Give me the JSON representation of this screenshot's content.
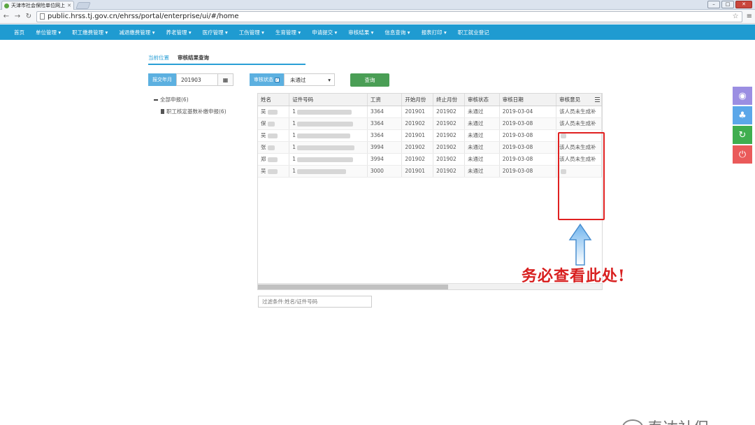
{
  "browser": {
    "tab_title": "天津市社会保险单位网上",
    "url": "public.hrss.tj.gov.cn/ehrss/portal/enterprise/ui/#/home"
  },
  "nav": {
    "items": [
      "首页",
      "单位管理 ▾",
      "职工缴费管理 ▾",
      "减退缴费管理 ▾",
      "养老管理 ▾",
      "医疗管理 ▾",
      "工伤管理 ▾",
      "生育管理 ▾",
      "申请提交 ▾",
      "审核结果 ▾",
      "信息查询 ▾",
      "报表打印 ▾",
      "职工就业登记"
    ]
  },
  "breadcrumb": {
    "label": "当前位置",
    "current": "审核结果查询"
  },
  "filters": {
    "period_label": "报交年月",
    "period_value": "201903",
    "status_label": "审核状态",
    "status_value": "未通过",
    "search_label": "查询"
  },
  "tree": {
    "root": "全部申报(6)",
    "child": "职工核定基数补缴申报(6)"
  },
  "table": {
    "columns": [
      "姓名",
      "证件号码",
      "工资",
      "开始月份",
      "终止月份",
      "审核状态",
      "审核日期",
      "审核意见"
    ],
    "rows": [
      {
        "name": "吴",
        "id": "1",
        "wage": "3364",
        "start": "201901",
        "end": "201902",
        "status": "未通过",
        "date": "2019-03-04",
        "opinion": "该人员未生成补"
      },
      {
        "name": "保",
        "id": "1",
        "wage": "3364",
        "start": "201902",
        "end": "201902",
        "status": "未通过",
        "date": "2019-03-08",
        "opinion": "该人员未生成补"
      },
      {
        "name": "吴",
        "id": "1",
        "wage": "3364",
        "start": "201901",
        "end": "201902",
        "status": "未通过",
        "date": "2019-03-08",
        "opinion": ""
      },
      {
        "name": "张",
        "id": "1",
        "wage": "3994",
        "start": "201902",
        "end": "201902",
        "status": "未通过",
        "date": "2019-03-08",
        "opinion": "该人员未生成补"
      },
      {
        "name": "郑",
        "id": "1",
        "wage": "3994",
        "start": "201902",
        "end": "201902",
        "status": "未通过",
        "date": "2019-03-08",
        "opinion": "该人员未生成补"
      },
      {
        "name": "吴",
        "id": "1",
        "wage": "3000",
        "start": "201901",
        "end": "201902",
        "status": "未通过",
        "date": "2019-03-08",
        "opinion": ""
      }
    ]
  },
  "grid_filter_placeholder": "过滤条件:姓名/证件号码",
  "callout": "务必查看此处!",
  "watermark": "泰达社保",
  "colors": {
    "nav": "#1f9bd1",
    "accent": "#2a9fd6",
    "search_button": "#4a9e55",
    "highlight": "#e02020"
  },
  "side_buttons": [
    "eye-icon",
    "tree-icon",
    "refresh-icon",
    "power-icon"
  ]
}
